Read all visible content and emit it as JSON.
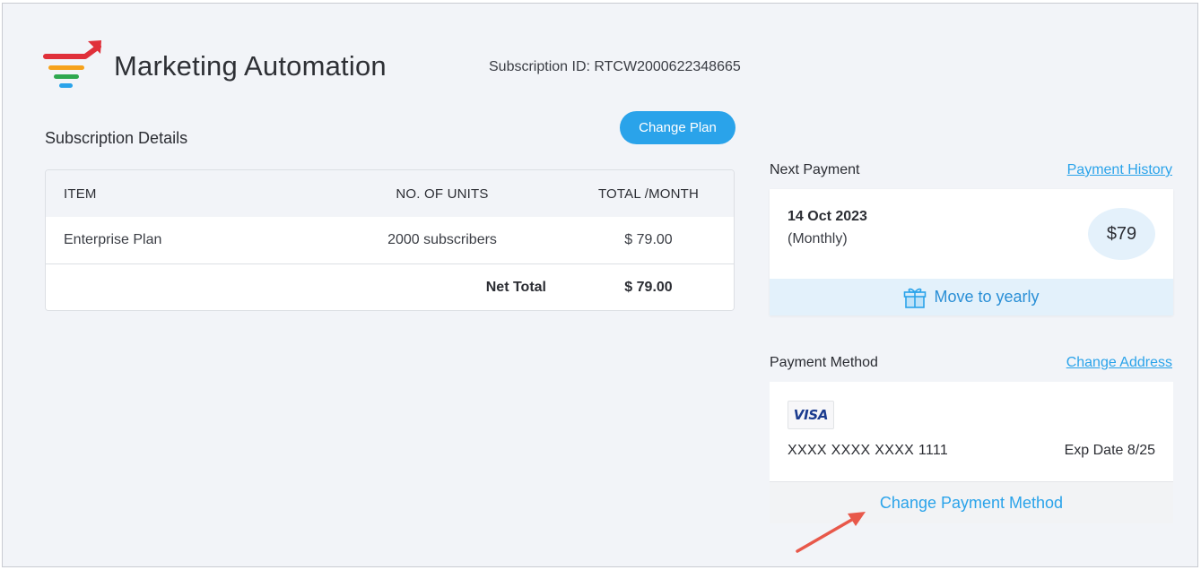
{
  "app": {
    "title": "Marketing Automation"
  },
  "subscription": {
    "id_text": "Subscription ID: RTCW2000622348665"
  },
  "details": {
    "title": "Subscription Details",
    "change_plan_label": "Change Plan",
    "columns": [
      "ITEM",
      "NO. OF UNITS",
      "TOTAL /MONTH"
    ],
    "rows": [
      {
        "item": "Enterprise Plan",
        "units": "2000 subscribers",
        "total": "$  79.00"
      }
    ],
    "net_total_label": "Net Total",
    "net_total_value": "$ 79.00"
  },
  "next_payment": {
    "title": "Next Payment",
    "history_link": "Payment History",
    "date": "14 Oct 2023",
    "period": "(Monthly)",
    "amount": "$79",
    "move_yearly_label": "Move to yearly"
  },
  "payment_method": {
    "title": "Payment Method",
    "change_address_link": "Change Address",
    "card_brand": "VISA",
    "card_number": "XXXX XXXX XXXX 1111",
    "expiry": "Exp Date 8/25",
    "change_method_label": "Change Payment Method"
  },
  "colors": {
    "accent": "#2aa3ea",
    "annotation_arrow": "#e8584a",
    "logo_red": "#e0303a",
    "logo_orange": "#f6a21c",
    "logo_green": "#2fa84f",
    "logo_blue": "#2aa3ea"
  },
  "icons": {
    "gift": "gift-icon",
    "logo": "marketing-automation-logo",
    "annotation": "annotation-arrow"
  }
}
